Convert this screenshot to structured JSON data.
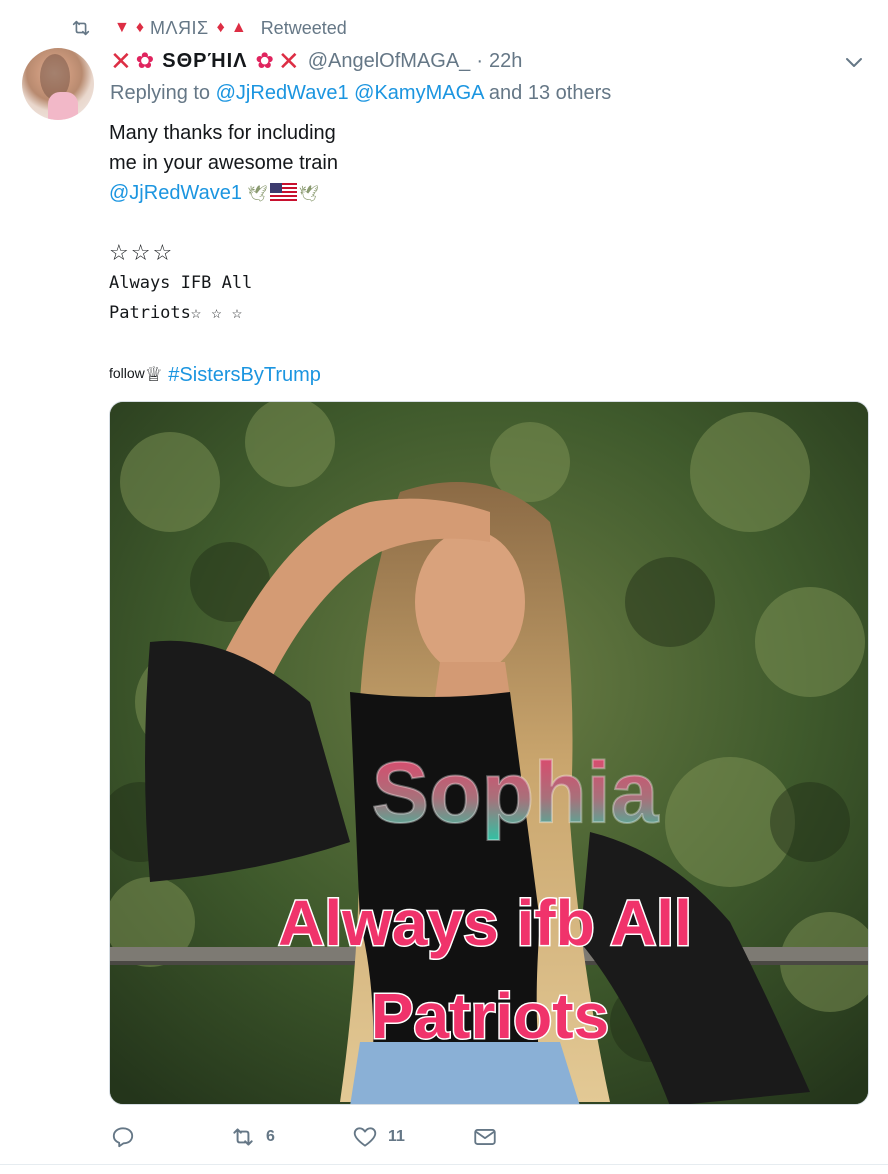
{
  "retweet_context": {
    "retweeter_name": "ΜΛЯΙΣ",
    "label": "Retweeted"
  },
  "tweet": {
    "display_name": "SΘPΉIΛ",
    "handle": "@AngelOfMAGA_",
    "separator": "·",
    "time": "22h",
    "reply": {
      "prefix": "Replying to",
      "mention_1": "@JjRedWave1",
      "mention_2": "@KamyMAGA",
      "suffix": "and 13 others"
    },
    "body": {
      "line1": "Many thanks for including",
      "line2": "me in your awesome train",
      "mention": "@JjRedWave1",
      "stars_line": "☆☆☆",
      "mono_line1": "Always IFB All",
      "mono_line2": "Patriots☆ ☆ ☆",
      "follow_small": "follow",
      "crown": "♕",
      "hashtag": "#SistersByTrump"
    },
    "media": {
      "overlay_title": "Sophia",
      "overlay_line1": "Always ifb All",
      "overlay_line2": "Patriots"
    },
    "actions": {
      "retweet_count": "6",
      "like_count": "11"
    }
  },
  "colors": {
    "link": "#1b95e0",
    "secondary_text": "#657786",
    "accent_red": "#dd2e44"
  },
  "icons": {
    "retweet": "retweet-icon",
    "caret": "chevron-down-icon",
    "reply": "reply-icon",
    "like": "heart-icon",
    "dm": "envelope-icon"
  }
}
